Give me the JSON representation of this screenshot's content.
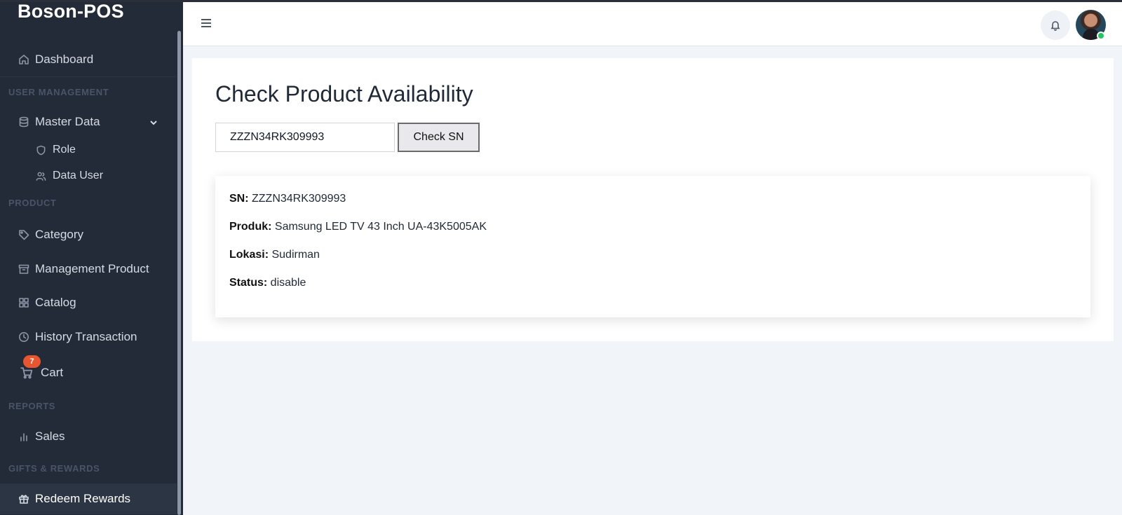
{
  "app": {
    "brand": "Boson-POS"
  },
  "sidebar": {
    "dashboard": "Dashboard",
    "sections": {
      "user_management": "USER MANAGEMENT",
      "product": "PRODUCT",
      "reports": "REPORTS",
      "gifts": "GIFTS & REWARDS"
    },
    "master_data": "Master Data",
    "role": "Role",
    "data_user": "Data User",
    "category": "Category",
    "management_product": "Management Product",
    "catalog": "Catalog",
    "history_transaction": "History Transaction",
    "cart": "Cart",
    "cart_count": "7",
    "sales": "Sales",
    "redeem_rewards": "Redeem Rewards"
  },
  "icons": [
    "home-icon",
    "database-icon",
    "chevron-down-icon",
    "shield-icon",
    "users-icon",
    "tag-icon",
    "archive-icon",
    "grid-icon",
    "clock-icon",
    "cart-icon",
    "bar-chart-icon",
    "gift-icon",
    "menu-icon",
    "bell-icon"
  ],
  "main": {
    "title": "Check Product Availability",
    "sn_value": "ZZZN34RK309993",
    "check_button": "Check SN",
    "result": {
      "sn_label": "SN:",
      "sn": "ZZZN34RK309993",
      "product_label": "Produk:",
      "product": "Samsung LED TV 43 Inch UA-43K5005AK",
      "location_label": "Lokasi:",
      "location": "Sudirman",
      "status_label": "Status:",
      "status": "disable"
    }
  },
  "colors": {
    "sidebar_bg": "#232b38",
    "badge": "#e8552f",
    "online": "#22c55e"
  }
}
